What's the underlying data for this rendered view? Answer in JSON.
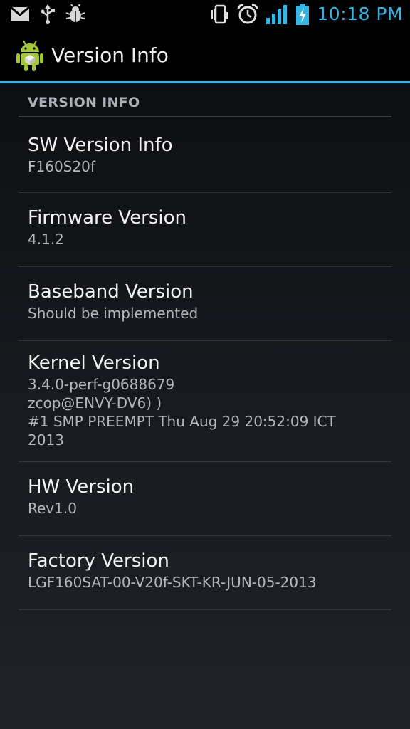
{
  "status_bar": {
    "time": "10:18 PM",
    "icons_left": [
      "gmail-icon",
      "usb-icon",
      "debug-bug-icon"
    ],
    "icons_right": [
      "vibrate-icon",
      "alarm-icon",
      "signal-icon",
      "battery-charging-icon"
    ],
    "accent_color": "#33b5e5"
  },
  "action_bar": {
    "title": "Version Info",
    "icon": "android-settings-icon"
  },
  "list": {
    "section_header": "VERSION INFO",
    "items": [
      {
        "title": "SW Version Info",
        "value": "F160S20f"
      },
      {
        "title": "Firmware Version",
        "value": "4.1.2"
      },
      {
        "title": "Baseband Version",
        "value": "Should be implemented"
      },
      {
        "title": "Kernel Version",
        "value": "3.4.0-perf-g0688679\nzcop@ENVY-DV6) )\n#1 SMP PREEMPT Thu Aug 29 20:52:09 ICT\n2013"
      },
      {
        "title": "HW Version",
        "value": "Rev1.0"
      },
      {
        "title": "Factory Version",
        "value": "LGF160SAT-00-V20f-SKT-KR-JUN-05-2013"
      }
    ]
  }
}
